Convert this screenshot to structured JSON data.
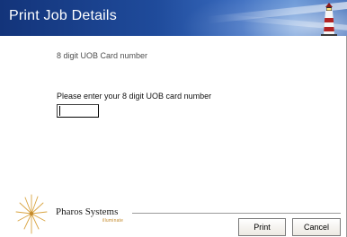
{
  "window": {
    "title": "Print Job Details"
  },
  "form": {
    "caption": "8 digit UOB Card number",
    "prompt": "Please enter your 8 digit UOB card number",
    "card_input_value": ""
  },
  "branding": {
    "company": "Pharos Systems",
    "tagline": "illuminate"
  },
  "buttons": {
    "print_label": "Print",
    "cancel_label": "Cancel"
  },
  "icons": {
    "header": "lighthouse-icon",
    "logo": "starburst-logo-icon"
  },
  "colors": {
    "header_dark": "#13347a",
    "header_light": "#5d8fd4",
    "logo_accent": "#c48a2c"
  }
}
